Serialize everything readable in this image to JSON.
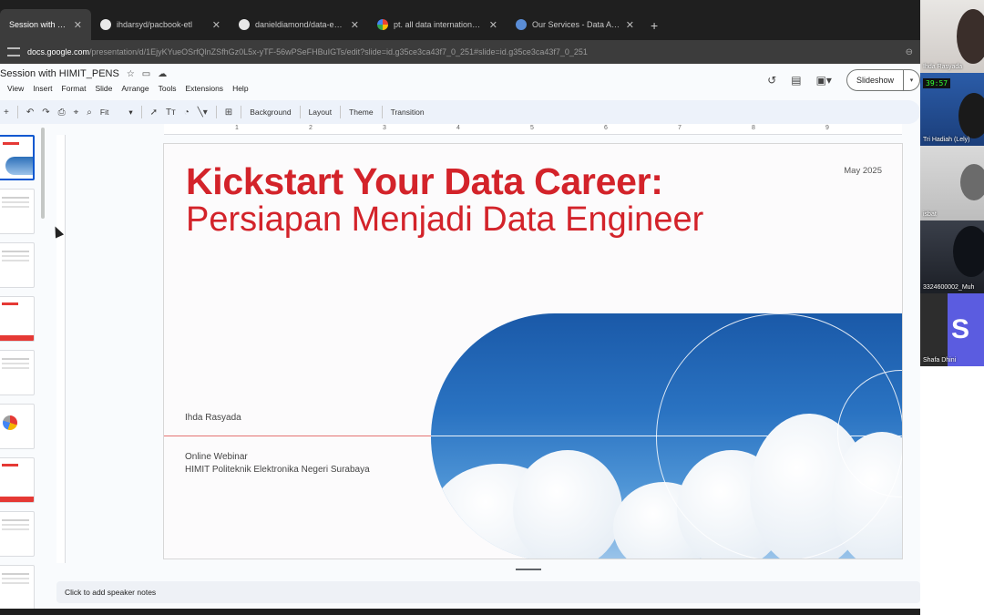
{
  "browser": {
    "tabs": [
      {
        "label": "Session with HIMIT PENS",
        "icon": "google-slides-icon",
        "active": true
      },
      {
        "label": "ihdarsyd/pacbook-etl",
        "icon": "github-icon"
      },
      {
        "label": "danieldiamond/data-engineerin",
        "icon": "github-icon"
      },
      {
        "label": "pt. all data international - Goog",
        "icon": "google-icon"
      },
      {
        "label": "Our Services - Data Analytics",
        "icon": "site-icon"
      }
    ],
    "new_tab": "+",
    "url_host": "docs.google.com",
    "url_path": "/presentation/d/1EjyKYueOSrfQlnZSfhGz0L5x-yTF-56wPSeFHBuIGTs/edit?slide=id.g35ce3ca43f7_0_251#slide=id.g35ce3ca43f7_0_251"
  },
  "docs": {
    "title": "Session with HIMIT_PENS",
    "menu": [
      "View",
      "Insert",
      "Format",
      "Slide",
      "Arrange",
      "Tools",
      "Extensions",
      "Help"
    ],
    "slideshow_label": "Slideshow",
    "toolbar": {
      "zoom": "Fit",
      "background": "Background",
      "layout": "Layout",
      "theme": "Theme",
      "transition": "Transition"
    },
    "ruler_marks": [
      "1",
      "2",
      "3",
      "4",
      "5",
      "6",
      "7",
      "8",
      "9"
    ],
    "notes_placeholder": "Click to add speaker notes"
  },
  "slide": {
    "title_line1": "Kickstart Your Data Career:",
    "title_line2": "Persiapan Menjadi Data Engineer",
    "date": "May 2025",
    "presenter": "Ihda Rasyada",
    "event_line1": "Online Webinar",
    "event_line2": "HIMIT Politeknik Elektronika Negeri Surabaya",
    "colors": {
      "accent": "#d3232a",
      "sky": "#1a59a8"
    }
  },
  "participants": [
    {
      "name": "Ihda Rasyada"
    },
    {
      "name": "Tri Hadiah (Lely)",
      "timer": "39:57"
    },
    {
      "name": "isbat"
    },
    {
      "name": "3324600002_Muh"
    },
    {
      "name": "Shafa Dhini",
      "initial": "S"
    }
  ]
}
